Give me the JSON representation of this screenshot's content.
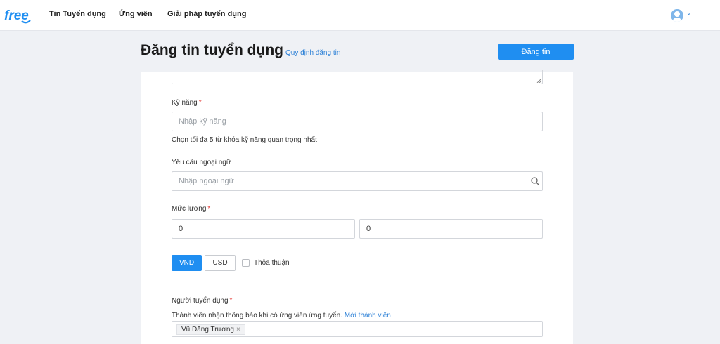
{
  "header": {
    "logo_text": "free",
    "nav": [
      "Tin Tuyển dụng",
      "Ứng viên",
      "Giải pháp tuyển dụng"
    ]
  },
  "page": {
    "title": "Đăng tin tuyển dụng",
    "rules_link": "Quy định đăng tin",
    "post_button": "Đăng tin"
  },
  "form": {
    "skills": {
      "label": "Kỹ năng",
      "required_mark": "*",
      "placeholder": "Nhập kỹ năng",
      "help": "Chọn tối đa 5 từ khóa kỹ năng quan trọng nhất"
    },
    "language": {
      "label": "Yêu cầu ngoại ngữ",
      "placeholder": "Nhập ngoại ngữ"
    },
    "salary": {
      "label": "Mức lương",
      "required_mark": "*",
      "min_value": "0",
      "max_value": "0",
      "currencies": [
        "VND",
        "USD"
      ],
      "selected_currency": "VND",
      "negotiable_label": "Thỏa thuận"
    },
    "recruiter": {
      "label": "Người tuyển dụng",
      "required_mark": "*",
      "help": "Thành viên nhận thông báo khi có ứng viên ứng tuyển.",
      "invite_link": "Mời thành viên",
      "selected": "Vũ Đăng Trương",
      "remove_symbol": "×"
    }
  },
  "colors": {
    "accent": "#1f8ef1",
    "link": "#2a7fd6",
    "required": "#e53935",
    "background": "#eff1f5"
  }
}
